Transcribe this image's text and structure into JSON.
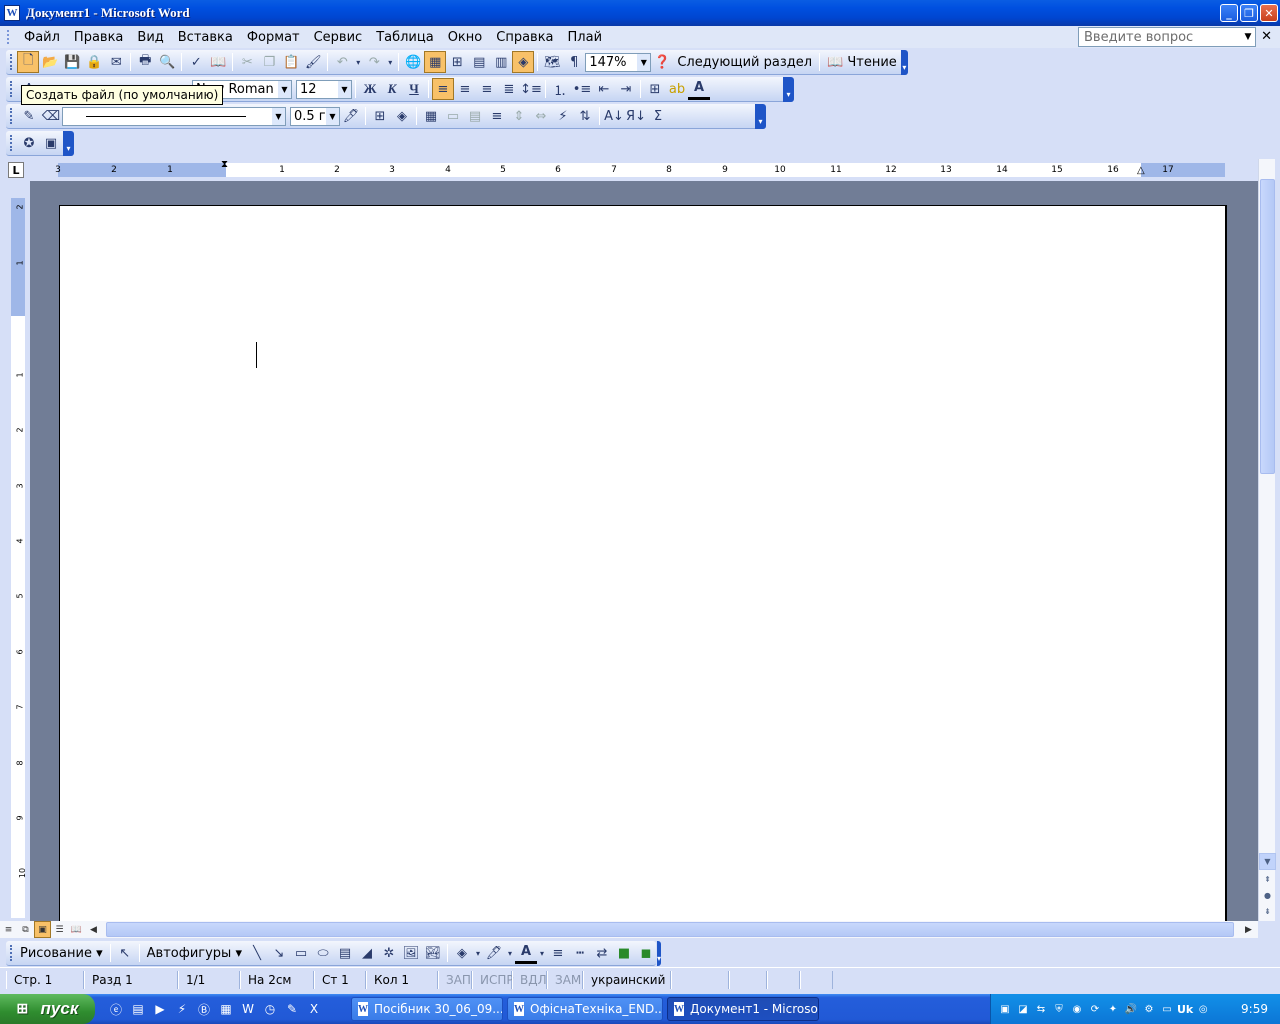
{
  "window": {
    "title": "Документ1 - Microsoft Word",
    "icon": "W"
  },
  "menu": {
    "items": [
      {
        "label": "Файл"
      },
      {
        "label": "Правка"
      },
      {
        "label": "Вид"
      },
      {
        "label": "Вставка"
      },
      {
        "label": "Формат"
      },
      {
        "label": "Сервис"
      },
      {
        "label": "Таблица"
      },
      {
        "label": "Окно"
      },
      {
        "label": "Справка"
      },
      {
        "label": "Плай"
      }
    ],
    "ask_placeholder": "Введите вопрос"
  },
  "standard_toolbar": {
    "zoom": "147%",
    "next_section": "Следующий раздел",
    "reading": "Чтение"
  },
  "formatting_toolbar": {
    "font_name": "New Roman",
    "font_size": "12",
    "bold": "Ж",
    "italic": "К",
    "underline": "Ч"
  },
  "tables_toolbar": {
    "line_weight": "0.5 г"
  },
  "tooltip": {
    "text": "Создать файл (по умолчанию)"
  },
  "ruler": {
    "labels": [
      "3",
      "2",
      "1",
      "1",
      "2",
      "3",
      "4",
      "5",
      "6",
      "7",
      "8",
      "9",
      "10",
      "11",
      "12",
      "13",
      "14",
      "15",
      "16",
      "17"
    ],
    "vertical_labels": [
      "2",
      "1",
      "1",
      "2",
      "3",
      "4",
      "5",
      "6",
      "7",
      "8",
      "9",
      "10"
    ]
  },
  "drawing_toolbar": {
    "drawing": "Рисование",
    "autoshapes": "Автофигуры"
  },
  "status": {
    "page": "Стр. 1",
    "section": "Разд 1",
    "pages": "1/1",
    "at": "На 2см",
    "line": "Ст 1",
    "col": "Кол 1",
    "rec": "ЗАП",
    "trk": "ИСПР",
    "ext": "ВДЛ",
    "ovr": "ЗАМ",
    "language": "украинский"
  },
  "taskbar": {
    "start": "пуск",
    "buttons": [
      {
        "label": "Посібник 30_06_09...."
      },
      {
        "label": "ОфіснаТехніка_END...."
      },
      {
        "label": "Документ1 - Microso..."
      }
    ],
    "lang": "Uk",
    "clock": "9:59"
  },
  "colors": {
    "titlebar": "#0a5de3",
    "accent_active": "#f8c168",
    "doc_background": "#717d96",
    "taskbar": "#245edb",
    "start_button": "#2f8d2f"
  }
}
